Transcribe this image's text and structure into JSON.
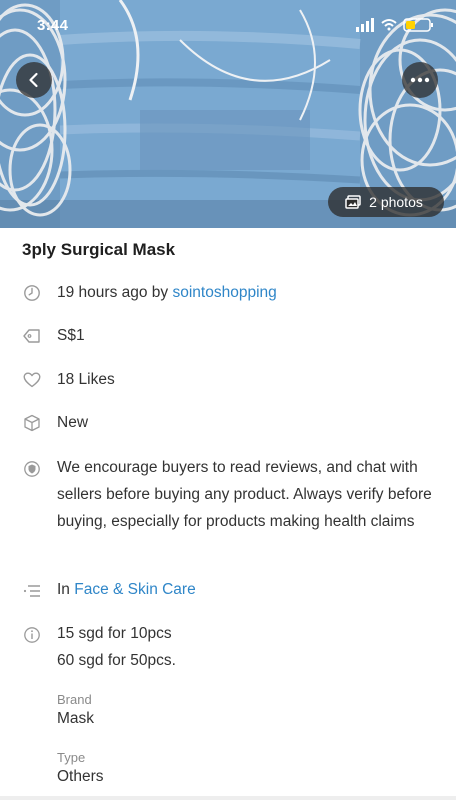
{
  "status_bar": {
    "time": "3:44"
  },
  "hero": {
    "photos_label": "2 photos"
  },
  "listing": {
    "title": "3ply Surgical Mask",
    "posted_prefix": "19 hours ago by",
    "seller": "sointoshopping",
    "price": "S$1",
    "likes": "18 Likes",
    "condition": "New",
    "notice": "We encourage buyers to read reviews, and chat with sellers before buying any product. Always verify before buying, especially for products making health claims",
    "category_prefix": "In",
    "category": "Face & Skin Care",
    "description_lines": [
      "15 sgd for 10pcs",
      "60 sgd for 50pcs."
    ],
    "brand_label": "Brand",
    "brand_value": "Mask",
    "type_label": "Type",
    "type_value": "Others"
  },
  "icons": {
    "back": "chevron-left-icon",
    "more": "more-horizontal-icon",
    "photos": "image-stack-icon",
    "clock": "clock-icon",
    "price": "price-tag-icon",
    "likes": "heart-icon",
    "condition": "box-icon",
    "notice": "shield-icon",
    "category": "list-icon",
    "info": "info-icon"
  },
  "colors": {
    "link": "#2f86c8",
    "icon": "#9a9a9a"
  }
}
